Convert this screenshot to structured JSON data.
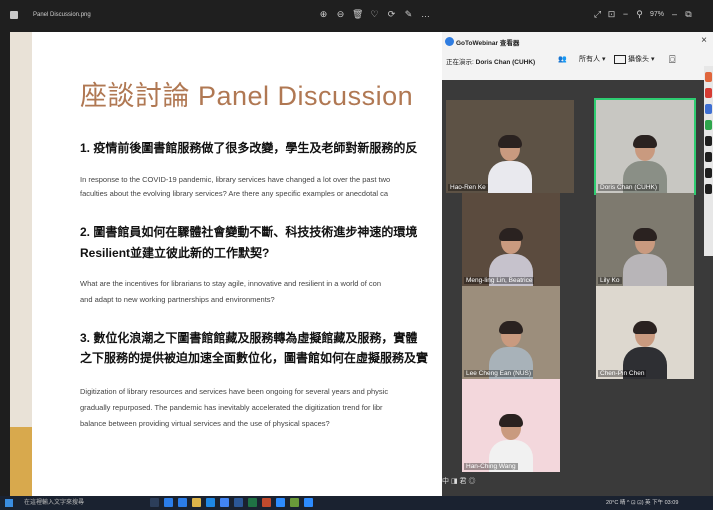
{
  "viewer": {
    "file_name": "Panel Discussion.png",
    "zoom": "97%"
  },
  "slide": {
    "title": "座談討論 Panel Discussion",
    "q1_head": "1.  疫情前後圖書館服務做了很多改變，學生及老師對新服務的反",
    "q1_body_1": "In response to the COVID-19 pandemic, library services have changed a lot over the past two",
    "q1_body_2": "faculties about the evolving library services? Are there any specific examples or anecdotal ca",
    "q2_head_1": "2.  圖書館員如何在驟體社會變動不斷、科技技術進步神速的環境",
    "q2_head_2": "Resilient並建立彼此新的工作默契?",
    "q2_body_1": "What are the incentives for librarians to stay agile, innovative and resilient in a world of con",
    "q2_body_2": "and adapt to new working partnerships and environments?",
    "q3_head_1": "3.  數位化浪潮之下圖書館館藏及服務轉為虛擬館藏及服務，實體",
    "q3_head_2": "之下服務的提供被迫加速全面數位化，圖書館如何在虛擬服務及實",
    "q3_body_1": "Digitization of library resources and services have been ongoing for several years and physic",
    "q3_body_2": "gradually repurposed. The pandemic has inevitably accelerated the digitization trend for libr",
    "q3_body_3": "balance between providing virtual services and the use of physical spaces?"
  },
  "webinar": {
    "title": "GoToWebinar 查看器",
    "presenter_label": "正在演示:",
    "presenter_name": "Doris Chan (CUHK)",
    "audience_label": "所有人",
    "camera_label": "攝像头",
    "participants": [
      {
        "name": "Hao-Ren Ke",
        "shirt": "#e9e9ee",
        "bg": "#5d5245"
      },
      {
        "name": "Doris Chan (CUHK)",
        "shirt": "#8a8f86",
        "bg": "#c8c7c2"
      },
      {
        "name": "Meng-ling Lin, Beatrice",
        "shirt": "#c6c2cc",
        "bg": "#5b4b3e"
      },
      {
        "name": "Lily Ko",
        "shirt": "#b8b5b8",
        "bg": "#7e7a6f"
      },
      {
        "name": "Lee Cheng Ean (NUS)",
        "shirt": "#a8b2b9",
        "bg": "#9c8e7c"
      },
      {
        "name": "Chen-Pin Chen",
        "shirt": "#2e2f33",
        "bg": "#ddd8cf"
      },
      {
        "name": "Han-Ching Wang",
        "shirt": "#f1f1f1",
        "bg": "#f3d7dc"
      }
    ],
    "footer_label": "中 ◨ 君 ◎"
  },
  "taskbar": {
    "search_placeholder": "在這裡輸入文字來搜尋",
    "tray_text": "20°C 晴 ^ ⊡ ⊡) 英 下午 03:09"
  }
}
